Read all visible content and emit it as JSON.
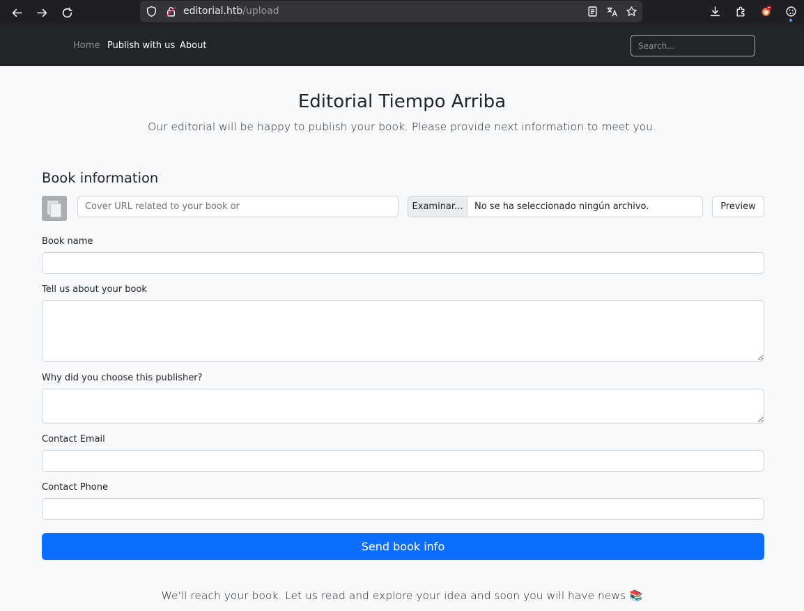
{
  "browser": {
    "url_host": "editorial.htb",
    "url_path": "/upload",
    "icons": [
      "back-icon",
      "forward-icon",
      "reload-icon",
      "shield-icon",
      "lock-icon",
      "reader-view-icon",
      "translate-icon",
      "bookmark-star-icon",
      "downloads-icon",
      "extensions-icon",
      "ublock-icon",
      "cookie-icon"
    ]
  },
  "navbar": {
    "links": [
      {
        "label": "Home",
        "active": false
      },
      {
        "label": "Publish with us",
        "active": true
      },
      {
        "label": "About",
        "active": true
      }
    ],
    "search_placeholder": "Search..."
  },
  "hero": {
    "title": "Editorial Tiempo Arriba",
    "subtitle": "Our editorial will be happy to publish your book. Please provide next information to meet you."
  },
  "form": {
    "section_title": "Book information",
    "cover_url_placeholder": "Cover URL related to your book or",
    "file_button": "Examinar...",
    "file_status": "No se ha seleccionado ningún archivo.",
    "preview_button": "Preview",
    "book_name_label": "Book name",
    "about_label": "Tell us about your book",
    "why_label": "Why did you choose this publisher?",
    "email_label": "Contact Email",
    "phone_label": "Contact Phone",
    "submit_label": "Send book info"
  },
  "footer": {
    "note": "We'll reach your book. Let us read and explore your idea and soon you will have news 📚"
  },
  "colors": {
    "primary": "#0d6efd",
    "navbar_bg": "#212529",
    "browser_bg": "#1f1e25",
    "page_bg": "#f8f9fa"
  }
}
